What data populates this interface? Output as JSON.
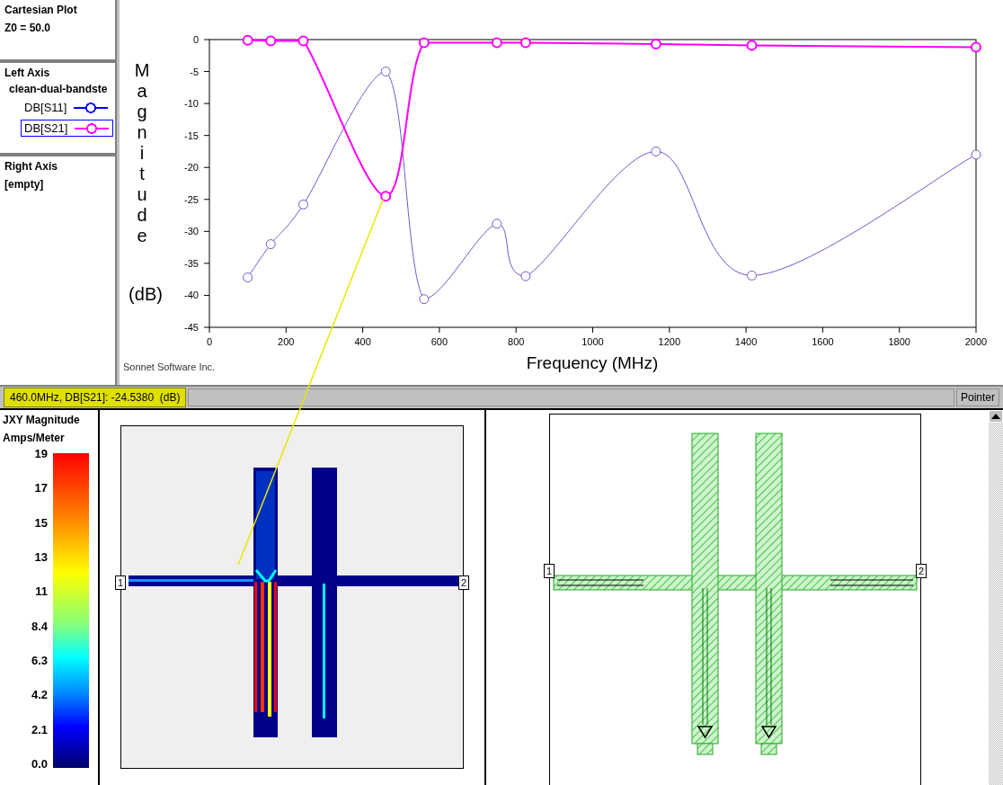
{
  "sidebar": {
    "title": "Cartesian Plot",
    "z0": "Z0 = 50.0",
    "left_axis": {
      "heading": "Left Axis",
      "project": "clean-dual-bandste",
      "traces": [
        {
          "color": "#0000ff",
          "selected": false
        },
        {
          "color": "#ff00ff",
          "selected": true
        }
      ]
    },
    "right_axis": {
      "heading": "Right Axis",
      "value": "[empty]"
    }
  },
  "plot": {
    "ylabel_unit": "(dB)",
    "credit": "Sonnet Software Inc.",
    "chart_data": {
      "type": "line",
      "xlabel": "Frequency (MHz)",
      "ylabel": "Magnitude",
      "x": [
        100,
        160,
        245,
        460,
        560,
        750,
        825,
        1165,
        1415,
        2000
      ],
      "series": [
        {
          "name": "DB[S11]",
          "color": "#6a5acd",
          "marker": "circle",
          "values": [
            -37.2,
            -32,
            -25.8,
            -5,
            -40.6,
            -28.8,
            -37,
            -17.5,
            -36.9,
            -18
          ]
        },
        {
          "name": "DB[S21]",
          "color": "#ff00ff",
          "marker": "circle",
          "values": [
            -0.1,
            -0.2,
            -0.2,
            -24.5,
            -0.5,
            -0.5,
            -0.5,
            -0.7,
            -0.9,
            -1.2
          ]
        }
      ],
      "xlim": [
        0,
        2000
      ],
      "ylim": [
        -45,
        0
      ],
      "xticks": [
        0,
        200,
        400,
        600,
        800,
        1000,
        1200,
        1400,
        1600,
        1800,
        2000
      ],
      "yticks": [
        0,
        -5,
        -10,
        -15,
        -20,
        -25,
        -30,
        -35,
        -40,
        -45
      ]
    }
  },
  "status_bar": {
    "readout": "460.0MHz, DB[S21]: -24.5380  (dB)",
    "button": "Pointer"
  },
  "current_legend": {
    "title": "JXY Magnitude",
    "unit": "Amps/Meter",
    "ticks": [
      "19",
      "17",
      "15",
      "13",
      "11",
      "8.4",
      "6.3",
      "4.2",
      "2.1",
      "0.0"
    ]
  },
  "current_view": {
    "ports": [
      "1",
      "2"
    ]
  },
  "layout_view": {
    "ports": [
      "1",
      "2"
    ]
  }
}
